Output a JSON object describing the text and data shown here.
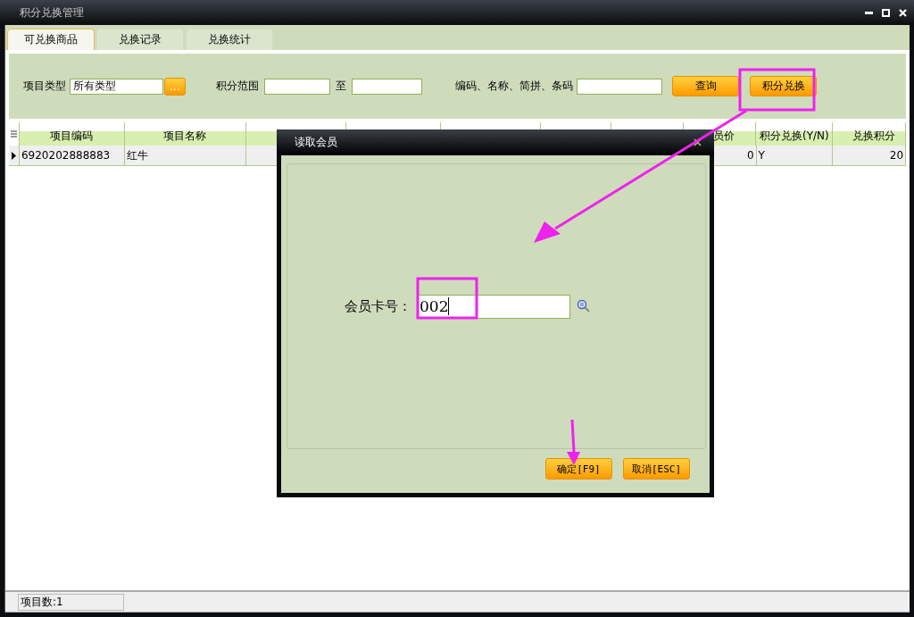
{
  "window": {
    "title": "积分兑换管理"
  },
  "tabs": [
    {
      "label": "可兑换商品",
      "selected": true
    },
    {
      "label": "兑换记录",
      "selected": false
    },
    {
      "label": "兑换统计",
      "selected": false
    }
  ],
  "filters": {
    "type_label": "项目类型",
    "type_value": "所有类型",
    "type_button": "...",
    "range_label": "积分范围",
    "range_to": "至",
    "search_label": "编码、名称、简拼、条码",
    "buttons": [
      {
        "label": "查询",
        "highlighted": false
      },
      {
        "label": "积分兑换",
        "highlighted": true
      }
    ]
  },
  "table": {
    "columns": [
      {
        "label": "项目编码",
        "kind": "text"
      },
      {
        "label": "项目名称",
        "kind": "text"
      },
      {
        "kind": "text"
      },
      {
        "kind": "text"
      },
      {
        "kind": "text"
      },
      {
        "kind": "text"
      },
      {
        "kind": "text"
      },
      {
        "label": "员价",
        "kind": "number"
      },
      {
        "label": "积分兑换(Y/N)",
        "kind": "text"
      },
      {
        "label": "兑换积分",
        "kind": "number"
      }
    ],
    "rows": [
      {
        "current": true,
        "cells": [
          "6920202888883",
          "红牛",
          null,
          null,
          null,
          null,
          null,
          "0",
          "Y",
          "20"
        ]
      }
    ]
  },
  "status_bar": {
    "text": "项目数:1"
  },
  "dialog": {
    "title": "读取会员",
    "card_label": "会员卡号：",
    "card_value": "002",
    "card_highlighted": true,
    "buttons": [
      {
        "label": "确定[F9]"
      },
      {
        "label": "取消[ESC]"
      }
    ]
  }
}
